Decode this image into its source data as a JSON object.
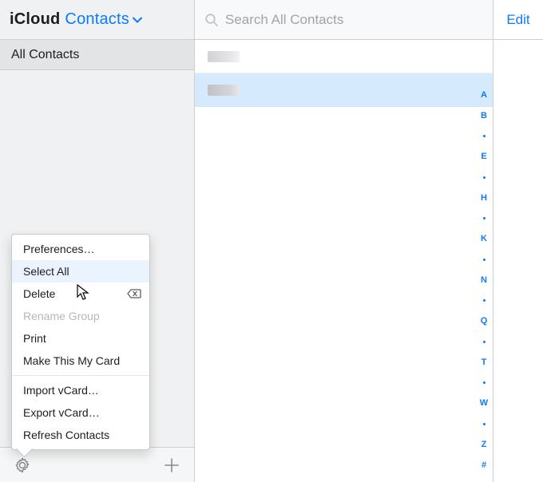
{
  "header": {
    "brand": "iCloud",
    "section": "Contacts",
    "search_placeholder": "Search All Contacts",
    "edit": "Edit"
  },
  "sidebar": {
    "groups": [
      {
        "label": "All Contacts"
      }
    ]
  },
  "contacts": {
    "rows": [
      {
        "selected": false
      },
      {
        "selected": true
      }
    ]
  },
  "alpha_index": [
    "A",
    "B",
    "·",
    "E",
    "·",
    "H",
    "·",
    "K",
    "·",
    "N",
    "·",
    "Q",
    "·",
    "T",
    "·",
    "W",
    "·",
    "Z",
    "#"
  ],
  "menu": {
    "sections": [
      [
        {
          "label": "Preferences…",
          "state": "normal"
        },
        {
          "label": "Select All",
          "state": "hover"
        },
        {
          "label": "Delete",
          "state": "normal",
          "shortcut_icon": "delete"
        },
        {
          "label": "Rename Group",
          "state": "disabled"
        },
        {
          "label": "Print",
          "state": "normal"
        },
        {
          "label": "Make This My Card",
          "state": "normal"
        }
      ],
      [
        {
          "label": "Import vCard…",
          "state": "normal"
        },
        {
          "label": "Export vCard…",
          "state": "normal"
        },
        {
          "label": "Refresh Contacts",
          "state": "normal"
        }
      ]
    ]
  }
}
